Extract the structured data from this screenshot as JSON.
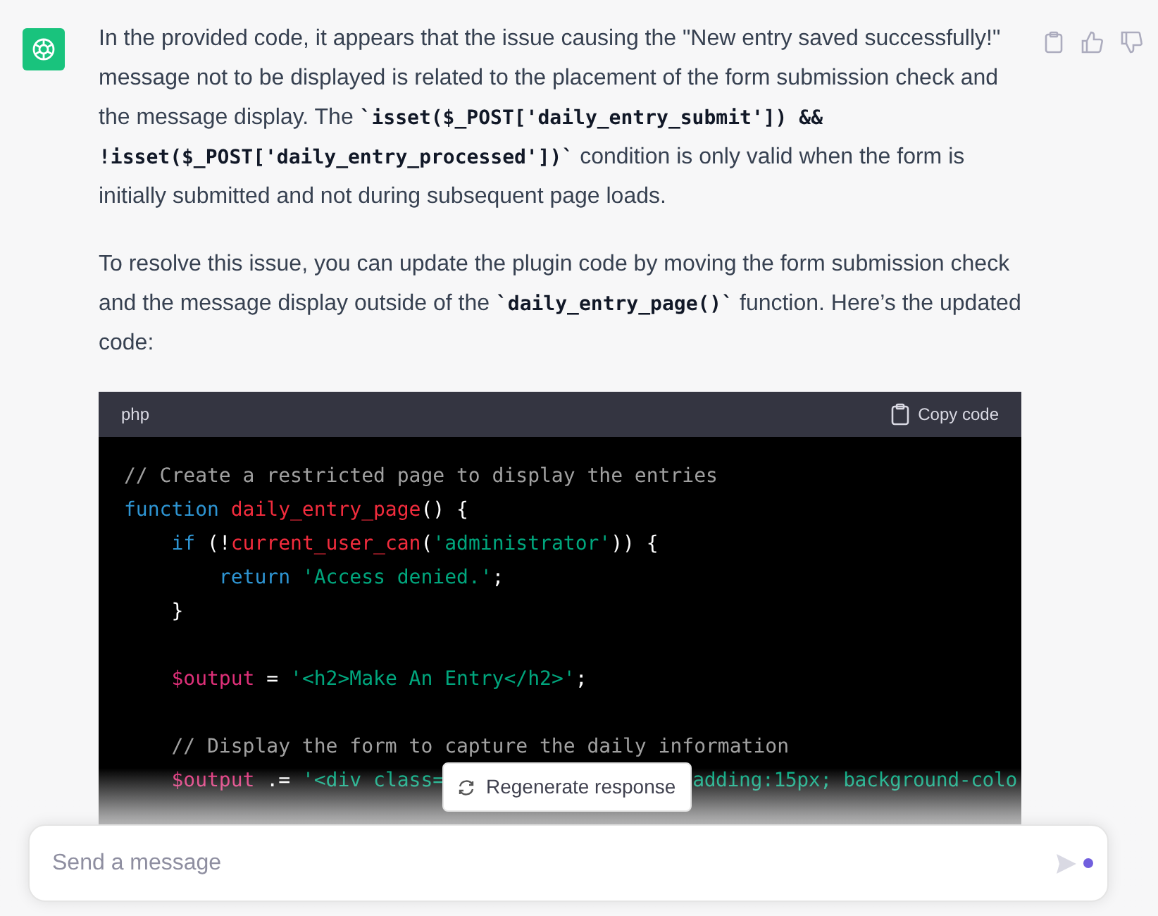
{
  "message": {
    "paragraphs": [
      [
        {
          "kind": "text",
          "text": "In the provided code, it appears that the issue causing the \"New entry saved successfully!\" message not to be displayed is related to the placement of the form submission check and the message display. The "
        },
        {
          "kind": "code",
          "text": "`isset($_POST['daily_entry_submit']) && !isset($_POST['daily_entry_processed'])`"
        },
        {
          "kind": "text",
          "text": " condition is only valid when the form is initially submitted and not during subsequent page loads."
        }
      ],
      [
        {
          "kind": "text",
          "text": "To resolve this issue, you can update the plugin code by moving the form submission check and the message display outside of the "
        },
        {
          "kind": "code",
          "text": "`daily_entry_page()`"
        },
        {
          "kind": "text",
          "text": " function. Here’s the updated code:"
        }
      ]
    ],
    "code_block": {
      "language": "php",
      "copy_label": "Copy code",
      "lines": [
        [
          {
            "kind": "comment",
            "text": "// Create a restricted page to display the entries"
          }
        ],
        [
          {
            "kind": "keyword",
            "text": "function "
          },
          {
            "kind": "function",
            "text": "daily_entry_page"
          },
          {
            "kind": "plain",
            "text": "() {"
          }
        ],
        [
          {
            "kind": "keyword",
            "text": "    if"
          },
          {
            "kind": "plain",
            "text": " (!"
          },
          {
            "kind": "function",
            "text": "current_user_can"
          },
          {
            "kind": "plain",
            "text": "("
          },
          {
            "kind": "string",
            "text": "'administrator'"
          },
          {
            "kind": "plain",
            "text": ")) {"
          }
        ],
        [
          {
            "kind": "keyword",
            "text": "        return "
          },
          {
            "kind": "string",
            "text": "'Access denied.'"
          },
          {
            "kind": "plain",
            "text": ";"
          }
        ],
        [
          {
            "kind": "plain",
            "text": "    }"
          }
        ],
        [
          {
            "kind": "variable",
            "text": "    $output",
            "blank_before": true
          },
          {
            "kind": "plain",
            "text": " = "
          },
          {
            "kind": "string",
            "text": "'<h2>Make An Entry</h2>'"
          },
          {
            "kind": "plain",
            "text": ";"
          }
        ],
        [
          {
            "kind": "comment",
            "text": "    // Display the form to capture the daily information",
            "blank_before": true
          }
        ],
        [
          {
            "kind": "variable",
            "text": "    $output"
          },
          {
            "kind": "plain",
            "text": " .= "
          },
          {
            "kind": "string",
            "text": "'<div class="
          },
          {
            "kind": "string_after_gap",
            "text": "adding:15px; background-colo"
          }
        ]
      ]
    }
  },
  "regenerate_button": "Regenerate response",
  "composer": {
    "placeholder": "Send a message"
  }
}
